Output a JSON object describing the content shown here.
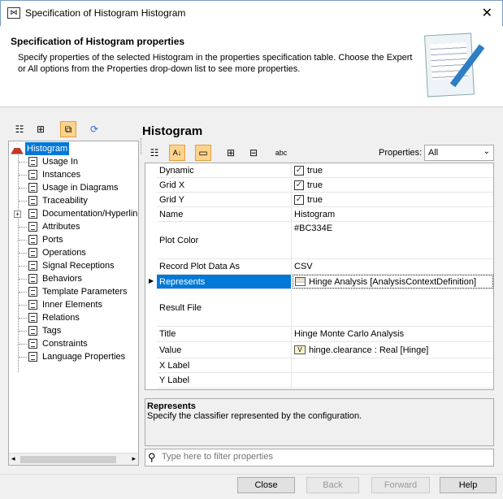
{
  "window": {
    "title": "Specification of Histogram Histogram"
  },
  "header": {
    "title": "Specification of Histogram properties",
    "description": "Specify properties of the selected Histogram in the properties specification table. Choose the Expert or All options from the Properties drop-down list to see more properties."
  },
  "tree": {
    "root": "Histogram",
    "items": [
      "Usage In",
      "Instances",
      "Usage in Diagrams",
      "Traceability",
      "Documentation/Hyperlinks",
      "Attributes",
      "Ports",
      "Operations",
      "Signal Receptions",
      "Behaviors",
      "Template Parameters",
      "Inner Elements",
      "Relations",
      "Tags",
      "Constraints",
      "Language Properties"
    ]
  },
  "panel": {
    "title": "Histogram",
    "properties_label": "Properties:",
    "properties_value": "All"
  },
  "properties": [
    {
      "name": "Dynamic",
      "value": "true",
      "type": "checkbox"
    },
    {
      "name": "Grid X",
      "value": "true",
      "type": "checkbox"
    },
    {
      "name": "Grid Y",
      "value": "true",
      "type": "checkbox"
    },
    {
      "name": "Name",
      "value": "Histogram"
    },
    {
      "name": "Plot Color",
      "value": "#BC334E"
    },
    {
      "name": "Record Plot Data As",
      "value": "CSV"
    },
    {
      "name": "Represents",
      "value": "Hinge Analysis [AnalysisContextDefinition]",
      "selected": true
    },
    {
      "name": "Result File",
      "value": ""
    },
    {
      "name": "Title",
      "value": "Hinge Monte Carlo Analysis"
    },
    {
      "name": "Value",
      "value": "hinge.clearance : Real [Hinge]"
    },
    {
      "name": "X Label",
      "value": ""
    },
    {
      "name": "Y Label",
      "value": ""
    }
  ],
  "description": {
    "title": "Represents",
    "text": "Specify the classifier represented by the configuration."
  },
  "filter": {
    "placeholder": "Type here to filter properties"
  },
  "buttons": {
    "close": "Close",
    "back": "Back",
    "forward": "Forward",
    "help": "Help"
  },
  "colors": {
    "selection": "#0078d7",
    "toolbar_active": "#fcd38c",
    "histogram_icon": "#c0392b"
  }
}
